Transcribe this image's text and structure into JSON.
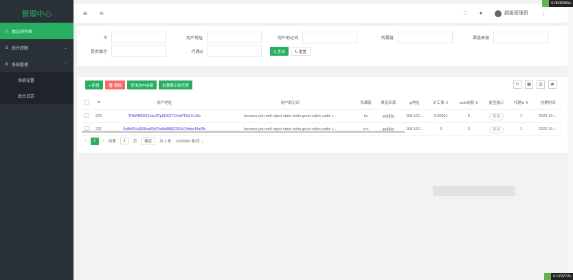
{
  "sidebar": {
    "title": "管理中心",
    "items": [
      {
        "label": "助记词列表",
        "icon": "clock-icon",
        "active": true
      },
      {
        "label": "后台权限",
        "icon": "user-icon",
        "chevron": "⌄"
      },
      {
        "label": "系统管理",
        "icon": "gear-icon",
        "chevron": "⌃"
      }
    ],
    "sub_items": [
      {
        "label": "系统设置"
      },
      {
        "label": "后台日志"
      }
    ]
  },
  "header": {
    "menu_icon": "☰",
    "refresh_icon": "↻",
    "fullscreen_icon": "⛶",
    "theme_icon": "●",
    "user": "超级管理员",
    "more_icon": "⋮"
  },
  "search": {
    "fields": [
      {
        "label": "id",
        "value": ""
      },
      {
        "label": "用户地址",
        "value": ""
      },
      {
        "label": "用户助记词",
        "value": ""
      },
      {
        "label": "所属链",
        "value": ""
      },
      {
        "label": "渠道来源",
        "value": ""
      },
      {
        "label": "是否展示",
        "value": ""
      },
      {
        "label": "代理id",
        "value": ""
      }
    ],
    "query_label": "Q 查询",
    "reset_label": "↻ 重置"
  },
  "toolbar": {
    "add_label": "+ 新增",
    "delete_label": "🗑 删除",
    "btn3_label": "查询选中余额",
    "btn4_label": "批量展示给代理"
  },
  "table": {
    "columns": [
      "id",
      "用户地址",
      "用户助记词",
      "所属链",
      "渠道来源",
      "ip地址",
      "矿工费 ⇕",
      "usdt余额 ⇕",
      "是否展示",
      "代理id ⇕",
      "创建时间"
    ],
    "rows": [
      [
        "222",
        "TNW4iRDZ2ckcZFp6D6371XzkPFb37nJ2s",
        "become job melt reject state violin grunt cabin cattle r...",
        "trc",
        "IM钱包",
        "108.162...",
        "0.00001",
        "0",
        "禁用",
        "1",
        "2022-10-..."
      ],
      [
        "221",
        "0x8bf16a360fca63d7fa8e88f83283d74ebc44af3b",
        "become job melt reject state violin grunt cabin cattle r...",
        "erc",
        "IM钱包",
        "108.162...",
        "0",
        "0",
        "禁用",
        "1",
        "2022-10-..."
      ]
    ]
  },
  "pager": {
    "current": "1",
    "goto_label": "到第",
    "page_value": "1",
    "page_unit": "页",
    "confirm": "确定",
    "total": "共 2 条",
    "per_page": "1000000 条/页 ⌄"
  },
  "badges": {
    "top": "0.0606065s",
    "bottom": "0.070272s"
  },
  "colors": {
    "accent": "#27ae60",
    "danger": "#f56c6c",
    "sidebar": "#2a3038"
  }
}
